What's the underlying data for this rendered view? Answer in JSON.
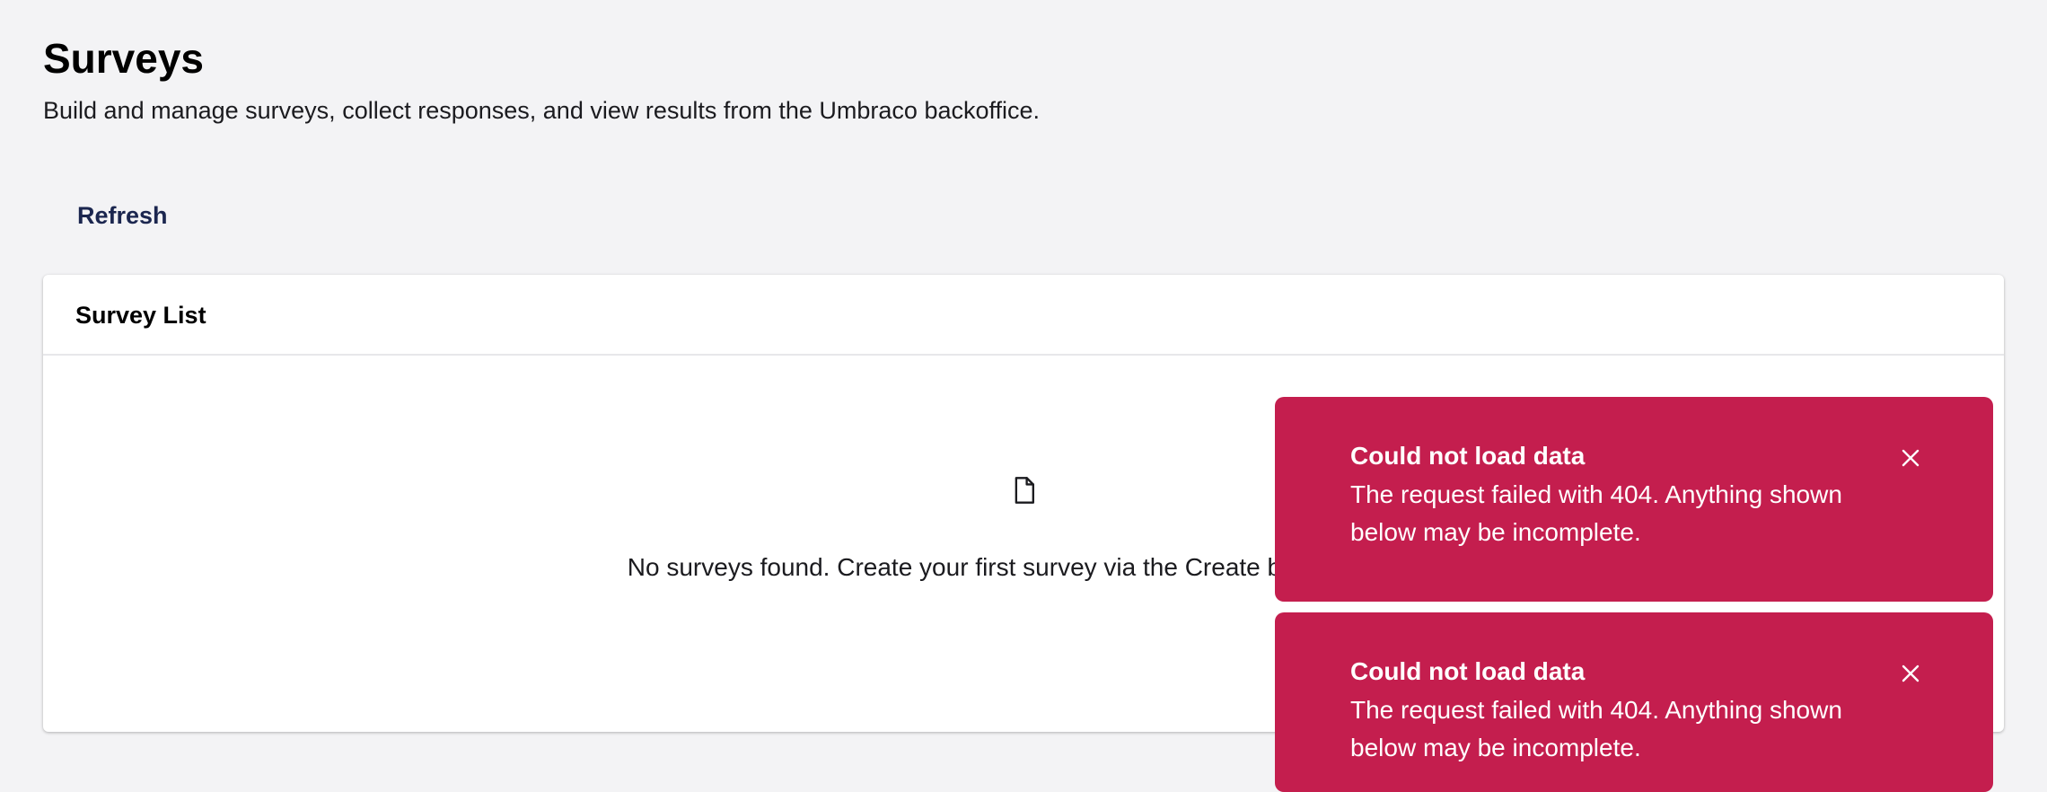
{
  "header": {
    "title": "Surveys",
    "subtitle": "Build and manage surveys, collect responses, and view results from the Umbraco backoffice."
  },
  "toolbar": {
    "refresh_label": "Refresh"
  },
  "survey_list": {
    "title": "Survey List",
    "empty_icon": "document-icon",
    "empty_message": "No surveys found. Create your first survey via the Create button above."
  },
  "notifications": [
    {
      "title": "Could not load data",
      "message": "The request failed with 404. Anything shown below may be incomplete.",
      "close_icon": "close-icon"
    },
    {
      "title": "Could not load data",
      "message": "The request failed with 404. Anything shown below may be incomplete.",
      "close_icon": "close-icon"
    }
  ],
  "colors": {
    "background": "#f3f3f5",
    "card": "#ffffff",
    "toast_danger": "#c41e4e",
    "refresh_text": "#1b264f"
  }
}
